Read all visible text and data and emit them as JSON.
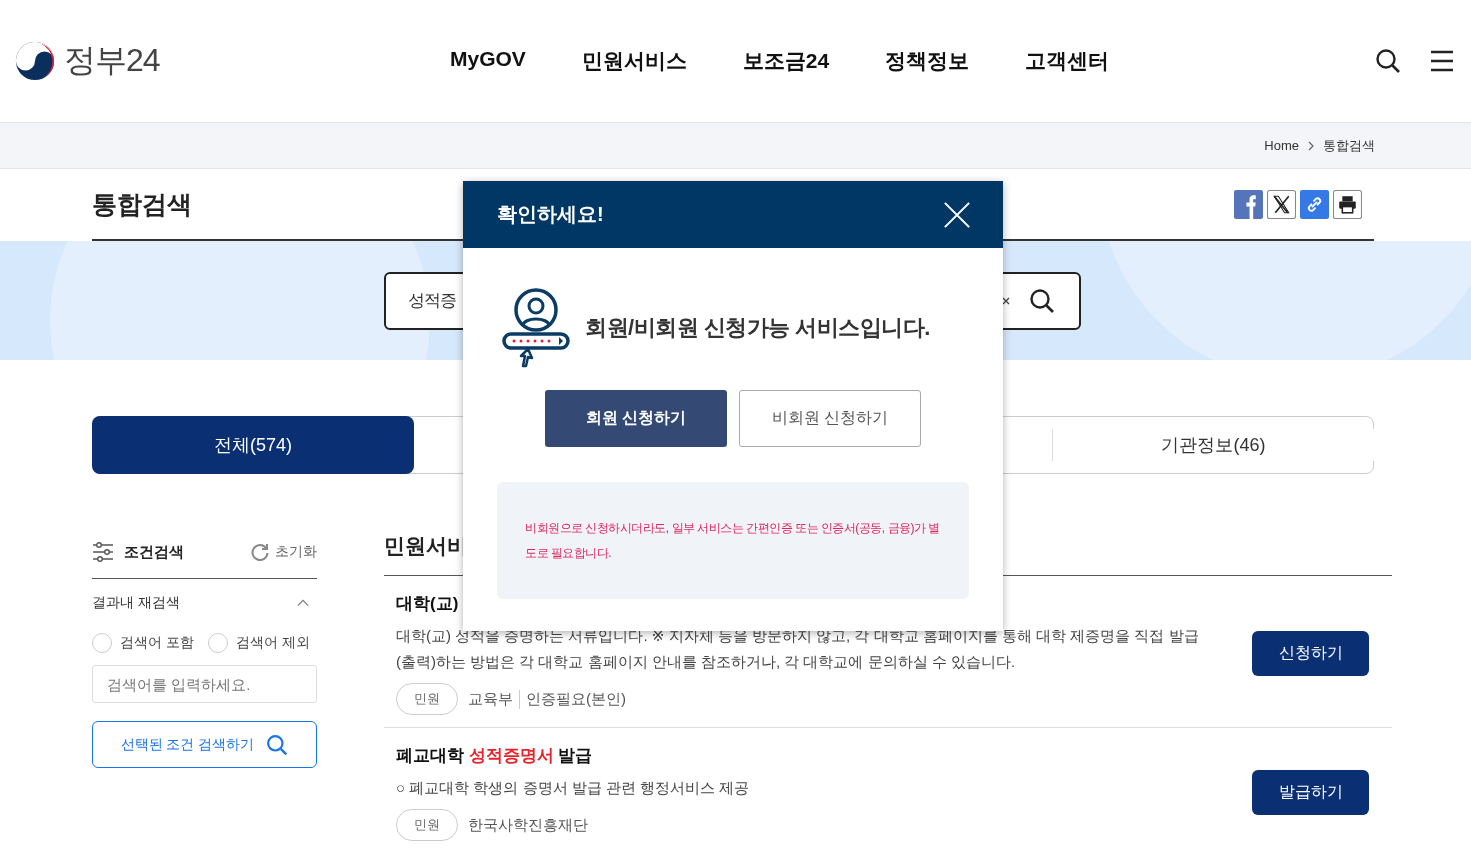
{
  "header": {
    "logo_text": "정부24",
    "nav": [
      "MyGOV",
      "민원서비스",
      "보조금24",
      "정책정보",
      "고객센터"
    ]
  },
  "breadcrumb": [
    "Home",
    "통합검색"
  ],
  "page_title": "통합검색",
  "search": {
    "value": "성적증"
  },
  "tabs": [
    {
      "label": "전체(574)",
      "selected": true
    },
    {
      "label": "기관정보(46)",
      "selected": false
    }
  ],
  "sidebar": {
    "title": "조건검색",
    "reset": "초기화",
    "section_title": "결과내 재검색",
    "expanded": true,
    "options": [
      {
        "label": "검색어 포함",
        "selected": false
      },
      {
        "label": "검색어 제외",
        "selected": false
      }
    ],
    "placeholder": "검색어를 입력하세요.",
    "button": "선택된 조건 검색하기"
  },
  "results": {
    "heading": "민원서비",
    "items": [
      {
        "title": "대학(교)",
        "description": "대학(교) 성적을 증명하는 서류입니다. ※ 지자체 등을 방문하지 않고, 각 대학교 홈페이지를 통해 대학 제증명을 직접 발급(출력)하는 방법은 각 대학교 홈페이지 안내를 참조하거나, 각 대학교에 문의하실 수 있습니다.",
        "tag": "민원",
        "meta": [
          "교육부",
          "인증필요(본인)"
        ],
        "button": "신청하기"
      },
      {
        "title": "폐교대학 ",
        "highlight": "성적증명서",
        "title_after": " 발급",
        "description": "○ 폐교대학 학생의 증명서 발급 관련 행정서비스 제공",
        "tag": "민원",
        "meta": [
          "한국사학진흥재단"
        ],
        "button": "발급하기"
      }
    ]
  },
  "modal": {
    "title": "확인하세요!",
    "message": "회원/비회원 신청가능 서비스입니다.",
    "buttons": [
      {
        "label": "회원 신청하기",
        "kind": "primary"
      },
      {
        "label": "비회원 신청하기",
        "kind": "secondary"
      }
    ],
    "notice": "비회원으로 신청하시더라도, 일부 서비스는 간편인증 또는 인증서(공동, 금융)가 별도로 필요합니다."
  }
}
